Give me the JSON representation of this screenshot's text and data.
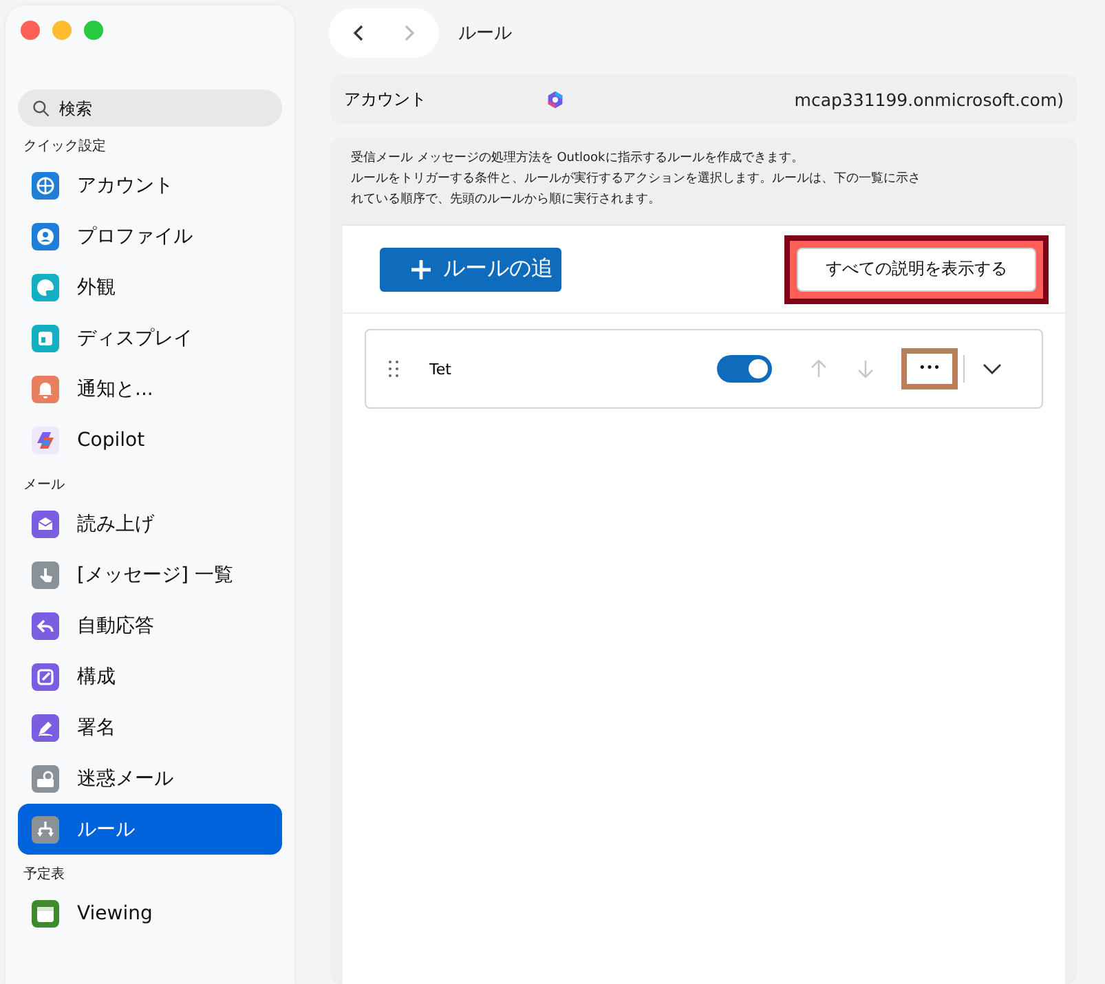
{
  "window": {
    "title": "ルール"
  },
  "sidebar": {
    "search": {
      "placeholder": "検索"
    },
    "sections": [
      {
        "title": "クイック設定",
        "items": [
          {
            "label": "アカウント",
            "kind": "globe",
            "color": "#1f7fd8",
            "selected": false
          },
          {
            "label": "プロファイル",
            "kind": "person",
            "color": "#1f7fd8",
            "selected": false
          },
          {
            "label": "外観",
            "kind": "palette",
            "color": "#13b0c2",
            "selected": false
          },
          {
            "label": "ディスプレイ",
            "kind": "layout",
            "color": "#13b0c2",
            "selected": false
          },
          {
            "label": "通知と...",
            "kind": "bell",
            "color": "#e8805f",
            "selected": false
          },
          {
            "label": "Copilot",
            "kind": "copilot",
            "color": "#eee8fb",
            "selected": false
          }
        ]
      },
      {
        "title": "メール",
        "items": [
          {
            "label": "読み上げ",
            "kind": "envelope",
            "color": "#7a5de0",
            "selected": false
          },
          {
            "label": "[メッセージ] 一覧",
            "kind": "touch",
            "color": "#8a9297",
            "selected": false
          },
          {
            "label": "自動応答",
            "kind": "reply",
            "color": "#7a5de0",
            "selected": false
          },
          {
            "label": "構成",
            "kind": "edit",
            "color": "#7a5de0",
            "selected": false
          },
          {
            "label": "署名",
            "kind": "pen",
            "color": "#7a5de0",
            "selected": false
          },
          {
            "label": "迷惑メール",
            "kind": "block",
            "color": "#8a9297",
            "selected": false
          },
          {
            "label": "ルール",
            "kind": "rules",
            "color": "#8a9297",
            "selected": true
          }
        ]
      },
      {
        "title": "予定表",
        "items": [
          {
            "label": "Viewing",
            "kind": "calendar",
            "color": "#3f8a2e",
            "selected": false
          }
        ]
      }
    ]
  },
  "account": {
    "label": "アカウント",
    "value": "mcap331199.onmicrosoft.com)"
  },
  "description_lines": [
    "受信メール メッセージの処理方法を Outlookに指示するルールを作成できます。",
    "ルールをトリガーする条件と、ルールが実行するアクションを選択します。ルールは、下の一覧に示さ",
    "れている順序で、先頭のルールから順に実行されます。"
  ],
  "add_rule_button": {
    "label": "ルールの追"
  },
  "show_all_button": {
    "label": "すべての説明を表示する",
    "outlined": true
  },
  "rules": [
    {
      "name": "Tet",
      "on": true,
      "move_up_disabled": true,
      "move_down_disabled": true,
      "more_outlined": true,
      "more_label": "•••"
    }
  ]
}
